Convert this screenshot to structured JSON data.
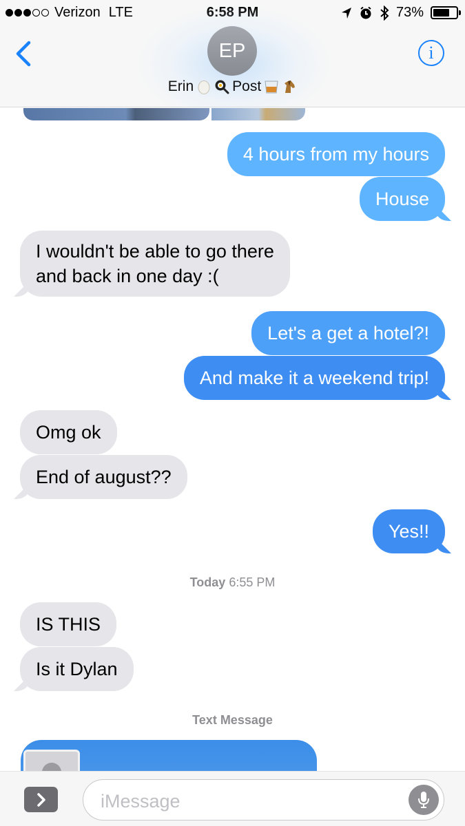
{
  "status_bar": {
    "carrier": "Verizon",
    "network": "LTE",
    "time": "6:58 PM",
    "battery_percent": "73%",
    "battery_level": 0.73,
    "signal_bars_filled": 3,
    "signal_bars_total": 5,
    "icons": [
      "location-arrow-icon",
      "alarm-icon",
      "bluetooth-icon",
      "battery-icon"
    ]
  },
  "header": {
    "back_icon": "chevron-left-icon",
    "avatar_initials": "EP",
    "contact_first": "Erin",
    "contact_last": "Post",
    "name_emojis": [
      "egg-emoji",
      "frying-pan-emoji",
      "whiskey-glass-emoji",
      "horse-emoji"
    ],
    "info_label": "i",
    "accent_color": "#1a82fb"
  },
  "messages": [
    {
      "from": "me",
      "text": "4 hours from my hours"
    },
    {
      "from": "me",
      "text": "House"
    },
    {
      "from": "them",
      "lines": [
        "I wouldn't be able to go there",
        "and back in one day :("
      ]
    },
    {
      "from": "me",
      "text": "Let's a get a hotel?!"
    },
    {
      "from": "me",
      "text": "And make it a weekend trip!"
    },
    {
      "from": "them",
      "text": "Omg ok"
    },
    {
      "from": "them",
      "text": "End of august??"
    },
    {
      "from": "me",
      "text": "Yes!!"
    },
    {
      "from": "them",
      "text": "IS THIS"
    },
    {
      "from": "them",
      "text": "Is it Dylan"
    }
  ],
  "timestamp": {
    "day": "Today",
    "time": "6:55 PM"
  },
  "service_label": "Text Message",
  "input": {
    "placeholder": "iMessage",
    "apps_icon": "chevron-right-icon",
    "mic_icon": "microphone-icon"
  },
  "colors": {
    "sent_bubble": "#5fb4ff",
    "sent_bubble_dark": "#3d8df2",
    "received_bubble": "#e5e5ea",
    "timestamp_gray": "#8e8e93"
  }
}
